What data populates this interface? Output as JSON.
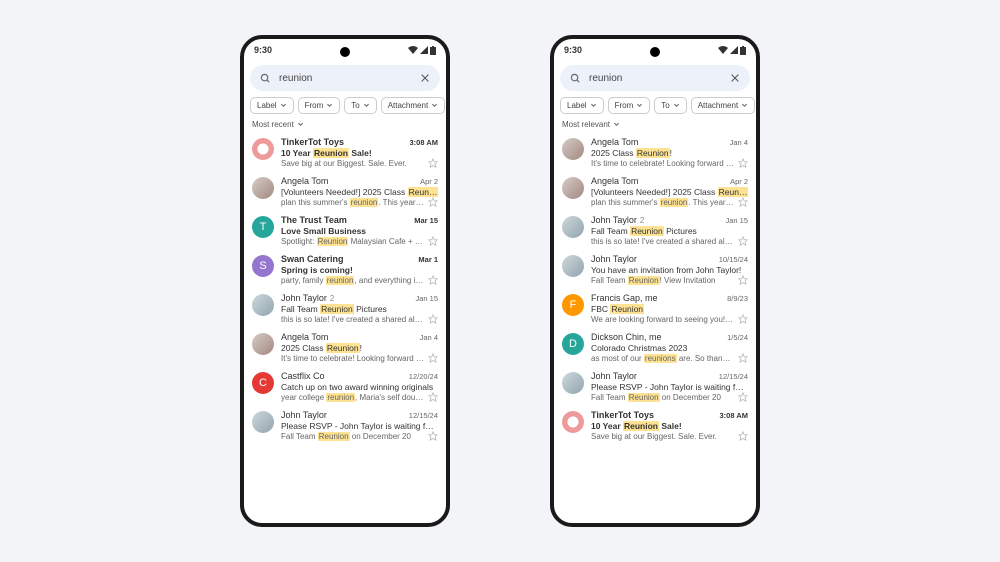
{
  "status": {
    "time": "9:30"
  },
  "search": {
    "value": "reunion"
  },
  "chips": {
    "label": "Label",
    "from": "From",
    "to": "To",
    "attachment": "Attachment"
  },
  "sort": {
    "recent": "Most recent",
    "relevant": "Most relevant"
  },
  "left": {
    "emails": [
      {
        "sender": "TinkerTot Toys",
        "bold": true,
        "threads": "",
        "time": "3:08 AM",
        "subjectParts": [
          "10 Year ",
          "Reunion",
          " Sale!"
        ],
        "subjectBold": true,
        "snippetParts": [
          "Save big at our Biggest. Sale. Ever."
        ],
        "avatarColor": "#e57373",
        "avatarLetter": "",
        "avatarImg": true,
        "avatarBg": "radial-gradient(circle, #fff 35%, #ef9a9a 36%)"
      },
      {
        "sender": "Angela Tom",
        "bold": false,
        "threads": "",
        "time": "Apr 2",
        "subjectParts": [
          "[Volunteers Needed!] 2025 Class ",
          "Reunion"
        ],
        "subjectBold": false,
        "snippetParts": [
          "plan this summer's ",
          "reunion",
          ". This year we're…"
        ],
        "avatarColor": "",
        "avatarLetter": "",
        "avatarImg": true,
        "avatarBg": "linear-gradient(135deg,#d7ccc8,#a1887f)"
      },
      {
        "sender": "The Trust Team",
        "bold": true,
        "threads": "",
        "time": "Mar 15",
        "subjectParts": [
          "Love Small Business"
        ],
        "subjectBold": true,
        "snippetParts": [
          "Spotlight: ",
          "Reunion",
          " Malaysian Cafe + Kitch…"
        ],
        "avatarColor": "#26a69a",
        "avatarLetter": "T",
        "avatarImg": false,
        "avatarBg": ""
      },
      {
        "sender": "Swan Catering",
        "bold": true,
        "threads": "",
        "time": "Mar 1",
        "subjectParts": [
          "Spring is coming!"
        ],
        "subjectBold": true,
        "snippetParts": [
          "party, family ",
          "reunion",
          ", and everything in bet…"
        ],
        "avatarColor": "#9575cd",
        "avatarLetter": "S",
        "avatarImg": false,
        "avatarBg": ""
      },
      {
        "sender": "John Taylor",
        "bold": false,
        "threads": "2",
        "time": "Jan 15",
        "subjectParts": [
          "Fall Team ",
          "Reunion",
          " Pictures"
        ],
        "subjectBold": false,
        "snippetParts": [
          "this is so late!  I've created a shared album t…"
        ],
        "avatarColor": "",
        "avatarLetter": "",
        "avatarImg": true,
        "avatarBg": "linear-gradient(135deg,#cfd8dc,#90a4ae)"
      },
      {
        "sender": "Angela Tom",
        "bold": false,
        "threads": "",
        "time": "Jan 4",
        "subjectParts": [
          "2025 Class ",
          "Reunion",
          "!"
        ],
        "subjectBold": false,
        "snippetParts": [
          "It's time to celebrate!  Looking forward to se…"
        ],
        "avatarColor": "",
        "avatarLetter": "",
        "avatarImg": true,
        "avatarBg": "linear-gradient(135deg,#d7ccc8,#a1887f)"
      },
      {
        "sender": "Castflix Co",
        "bold": false,
        "threads": "",
        "time": "12/20/24",
        "subjectParts": [
          "Catch up on two award winning originals"
        ],
        "subjectBold": false,
        "snippetParts": [
          "year college ",
          "reunion",
          ", Maria's self doubt and…"
        ],
        "avatarColor": "#e53935",
        "avatarLetter": "C",
        "avatarImg": false,
        "avatarBg": ""
      },
      {
        "sender": "John Taylor",
        "bold": false,
        "threads": "",
        "time": "12/15/24",
        "subjectParts": [
          "Please RSVP - John Taylor is waiting for you…"
        ],
        "subjectBold": false,
        "snippetParts": [
          "Fall Team ",
          "Reunion",
          " on December 20"
        ],
        "avatarColor": "",
        "avatarLetter": "",
        "avatarImg": true,
        "avatarBg": "linear-gradient(135deg,#cfd8dc,#90a4ae)"
      }
    ]
  },
  "right": {
    "emails": [
      {
        "sender": "Angela Tom",
        "bold": false,
        "threads": "",
        "time": "Jan 4",
        "subjectParts": [
          "2025 Class ",
          "Reunion",
          "!"
        ],
        "subjectBold": false,
        "snippetParts": [
          "It's time to celebrate!  Looking forward to se…"
        ],
        "avatarColor": "",
        "avatarLetter": "",
        "avatarImg": true,
        "avatarBg": "linear-gradient(135deg,#d7ccc8,#a1887f)"
      },
      {
        "sender": "Angela Tom",
        "bold": false,
        "threads": "",
        "time": "Apr 2",
        "subjectParts": [
          "[Volunteers Needed!] 2025 Class ",
          "Reunion"
        ],
        "subjectBold": false,
        "snippetParts": [
          "plan this summer's ",
          "reunion",
          ". This year we're…"
        ],
        "avatarColor": "",
        "avatarLetter": "",
        "avatarImg": true,
        "avatarBg": "linear-gradient(135deg,#d7ccc8,#a1887f)"
      },
      {
        "sender": "John Taylor",
        "bold": false,
        "threads": "2",
        "time": "Jan 15",
        "subjectParts": [
          "Fall Team ",
          "Reunion",
          " Pictures"
        ],
        "subjectBold": false,
        "snippetParts": [
          "this is so late!  I've created a shared album t…"
        ],
        "avatarColor": "",
        "avatarLetter": "",
        "avatarImg": true,
        "avatarBg": "linear-gradient(135deg,#cfd8dc,#90a4ae)"
      },
      {
        "sender": "John Taylor",
        "bold": false,
        "threads": "",
        "time": "10/15/24",
        "subjectParts": [
          "You have an invitation from John Taylor!"
        ],
        "subjectBold": false,
        "snippetParts": [
          "Fall Team ",
          "Reunion",
          "! View Invitation"
        ],
        "avatarColor": "",
        "avatarLetter": "",
        "avatarImg": true,
        "avatarBg": "linear-gradient(135deg,#cfd8dc,#90a4ae)"
      },
      {
        "sender": "Francis Gap, me",
        "bold": false,
        "threads": "",
        "time": "8/9/23",
        "subjectParts": [
          "FBC ",
          "Reunion"
        ],
        "subjectBold": false,
        "snippetParts": [
          "We are looking forward to seeing you!  Our…"
        ],
        "avatarColor": "#ff9800",
        "avatarLetter": "F",
        "avatarImg": false,
        "avatarBg": ""
      },
      {
        "sender": "Dickson Chin, me",
        "bold": false,
        "threads": "",
        "time": "1/5/24",
        "subjectParts": [
          "Colorado Christmas 2023"
        ],
        "subjectBold": false,
        "snippetParts": [
          "as most of our ",
          "reunions",
          " are.  So thankful for…"
        ],
        "avatarColor": "#26a69a",
        "avatarLetter": "D",
        "avatarImg": false,
        "avatarBg": ""
      },
      {
        "sender": "John Taylor",
        "bold": false,
        "threads": "",
        "time": "12/15/24",
        "subjectParts": [
          "Please RSVP - John Taylor is waiting for you…"
        ],
        "subjectBold": false,
        "snippetParts": [
          "Fall Team ",
          "Reunion",
          " on December 20"
        ],
        "avatarColor": "",
        "avatarLetter": "",
        "avatarImg": true,
        "avatarBg": "linear-gradient(135deg,#cfd8dc,#90a4ae)"
      },
      {
        "sender": "TinkerTot Toys",
        "bold": true,
        "threads": "",
        "time": "3:08 AM",
        "subjectParts": [
          "10 Year ",
          "Reunion",
          " Sale!"
        ],
        "subjectBold": true,
        "snippetParts": [
          "Save big at our Biggest. Sale. Ever."
        ],
        "avatarColor": "#e57373",
        "avatarLetter": "",
        "avatarImg": true,
        "avatarBg": "radial-gradient(circle, #fff 35%, #ef9a9a 36%)"
      }
    ]
  }
}
